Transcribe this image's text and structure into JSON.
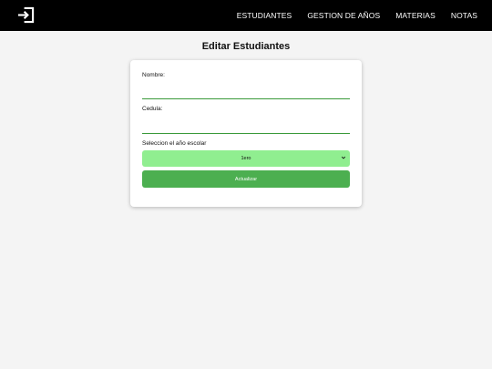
{
  "navbar": {
    "logout_icon": "logout-icon",
    "links": [
      {
        "label": "ESTUDIANTES"
      },
      {
        "label": "GESTION DE AÑOS"
      },
      {
        "label": "MATERIAS"
      },
      {
        "label": "NOTAS"
      }
    ]
  },
  "page": {
    "title": "Editar Estudiantes"
  },
  "form": {
    "nombre_label": "Nombre:",
    "nombre_value": "",
    "cedula_label": "Cedula:",
    "cedula_value": "",
    "year_label": "Seleccion el año escolar",
    "year_selected": "1ero",
    "submit_label": "Actualizar"
  },
  "colors": {
    "navbar_bg": "#000000",
    "select_bg": "#90ee90",
    "button_bg": "#4caf50",
    "input_underline": "#3a9a3a"
  }
}
